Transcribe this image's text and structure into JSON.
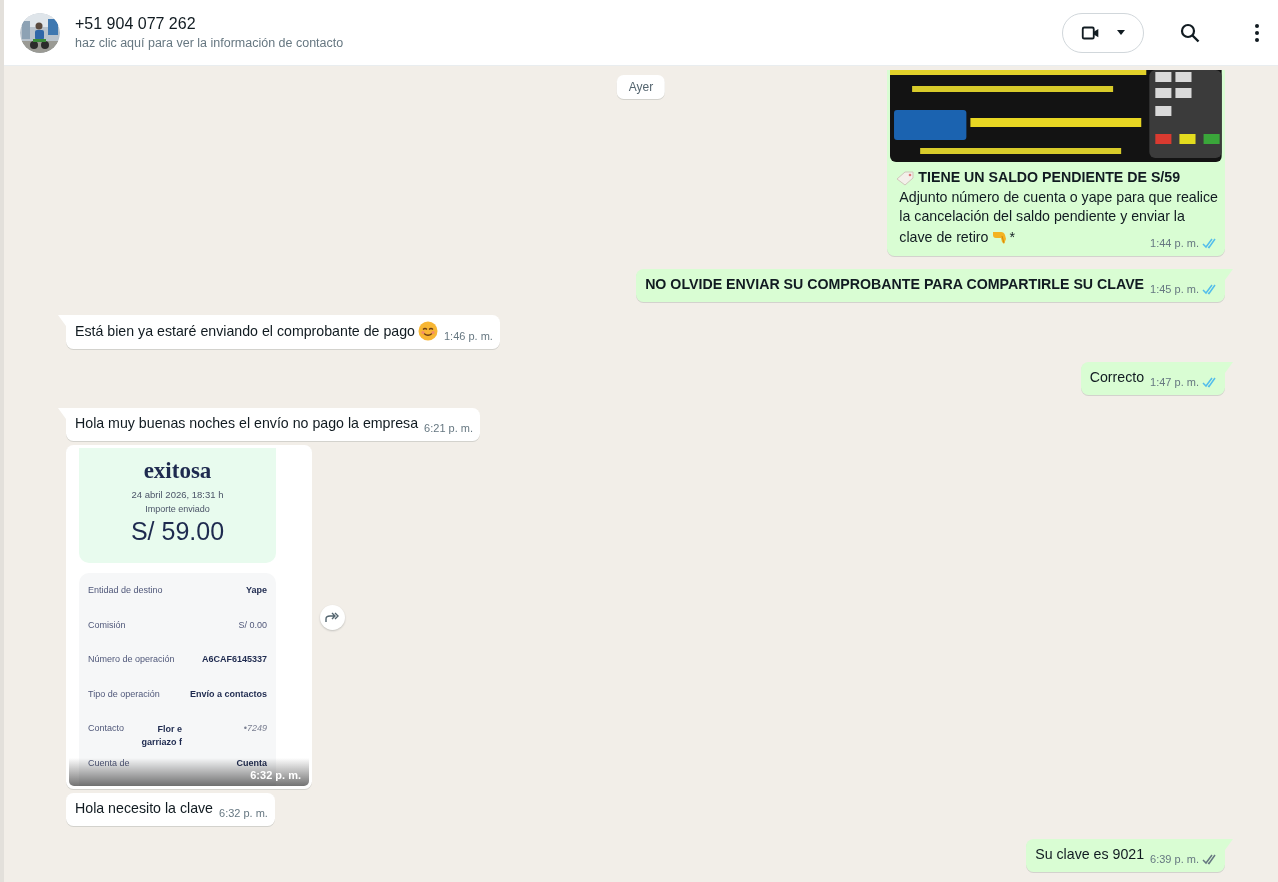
{
  "header": {
    "name": "+51 904 077 262",
    "subtitle": "haz clic aquí para ver la información de contacto"
  },
  "date_chip": "Ayer",
  "messages": [
    {
      "kind": "image_caption",
      "outgoing": true,
      "tail": false,
      "title": "TIENE UN SALDO PENDIENTE DE S/59",
      "body_lines": [
        "Adjunto número de cuenta o yape para que realice",
        "la cancelación del saldo pendiente y enviar la",
        "clave de retiro"
      ],
      "suffix": "*",
      "time": "1:44 p. m.",
      "read": true
    },
    {
      "kind": "text",
      "outgoing": true,
      "tail": true,
      "bold": true,
      "text": "NO OLVIDE ENVIAR SU COMPROBANTE PARA COMPARTIRLE SU CLAVE",
      "time": "1:45 p. m.",
      "read": true
    },
    {
      "kind": "text_icon",
      "outgoing": false,
      "tail": true,
      "bold": false,
      "text": "Está bien ya estaré enviando el comprobante de pago",
      "time": "1:46 p. m."
    },
    {
      "kind": "text",
      "outgoing": true,
      "tail": true,
      "bold": false,
      "text": "Correcto",
      "time": "1:47 p. m.",
      "read": true
    },
    {
      "kind": "text",
      "outgoing": false,
      "tail": true,
      "bold": false,
      "text": "Hola muy buenas noches el envío no pago la empresa",
      "time": "6:21 p. m."
    },
    {
      "kind": "receipt",
      "outgoing": false,
      "tail": false,
      "time": "6:32 p. m.",
      "receipt": {
        "title": "exitosa",
        "date": "24 abril 2026, 18:31 h",
        "amount_label": "Importe enviado",
        "amount": "S/ 59.00",
        "rows": [
          {
            "label": "Entidad de destino",
            "value": "Yape",
            "bold": true
          },
          {
            "label": "Comisión",
            "value": "S/ 0.00",
            "bold": false
          },
          {
            "label": "Número de operación",
            "value": "A6CAF6145337",
            "bold": true
          },
          {
            "label": "Tipo de operación",
            "value": "Envío a contactos",
            "bold": true
          },
          {
            "label": "Contacto",
            "value": "Flor e garriazo f",
            "extra": "•7249",
            "bold": true
          },
          {
            "label": "Cuenta de",
            "value": "Cuenta",
            "bold": true
          }
        ]
      }
    },
    {
      "kind": "text",
      "outgoing": false,
      "tail": false,
      "bold": false,
      "text": "Hola necesito la clave",
      "time": "6:32 p. m."
    },
    {
      "kind": "text",
      "outgoing": true,
      "tail": true,
      "bold": false,
      "text": "Su clave es 9021",
      "time": "6:39 p. m.",
      "read": false
    }
  ]
}
